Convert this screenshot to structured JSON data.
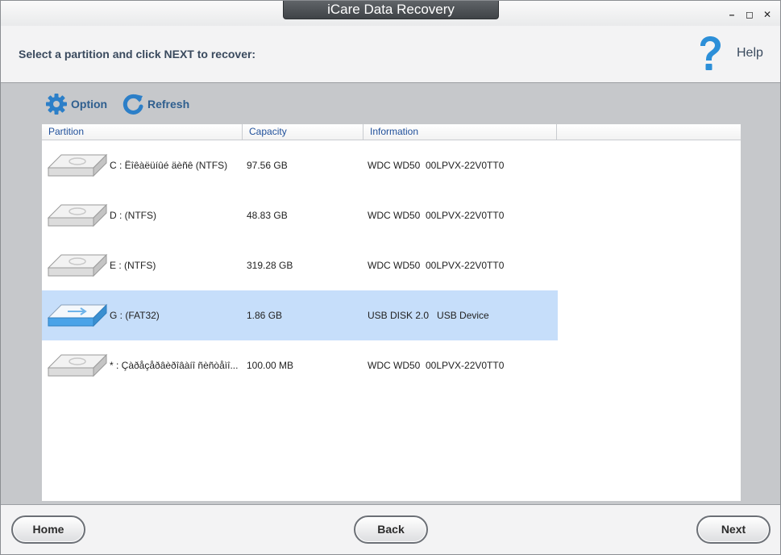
{
  "window": {
    "title": "iCare Data Recovery",
    "controls": {
      "minimize": "–",
      "maximize": "◻",
      "close": "✕"
    }
  },
  "header": {
    "instruction": "Select a partition and click NEXT to recover:",
    "help_label": "Help",
    "help_icon": "question-mark-icon"
  },
  "toolbar": {
    "option_label": "Option",
    "refresh_label": "Refresh"
  },
  "table": {
    "columns": [
      "Partition",
      "Capacity",
      "Information"
    ],
    "rows": [
      {
        "partition": "C : Ëîêàëüíûé äèñê  (NTFS)",
        "capacity": "97.56 GB",
        "information": "WDC WD50  00LPVX-22V0TT0",
        "icon": "hard-disk-icon",
        "selected": false
      },
      {
        "partition": "D :   (NTFS)",
        "capacity": "48.83 GB",
        "information": "WDC WD50  00LPVX-22V0TT0",
        "icon": "hard-disk-icon",
        "selected": false
      },
      {
        "partition": "E :   (NTFS)",
        "capacity": "319.28 GB",
        "information": "WDC WD50  00LPVX-22V0TT0",
        "icon": "hard-disk-icon",
        "selected": false
      },
      {
        "partition": "G :   (FAT32)",
        "capacity": "1.86 GB",
        "information": "USB DISK 2.0   USB Device",
        "icon": "usb-disk-icon",
        "selected": true
      },
      {
        "partition": "* : Çàðåçåðâèðîâàíî ñèñòåìî...",
        "capacity": "100.00 MB",
        "information": "WDC WD50  00LPVX-22V0TT0",
        "icon": "hard-disk-icon",
        "selected": false
      }
    ]
  },
  "footer": {
    "home_label": "Home",
    "back_label": "Back",
    "next_label": "Next"
  },
  "colors": {
    "accent": "#2f5f8f",
    "selected_row": "#c6defa",
    "help_icon": "#2c8fd8",
    "usb_accent": "#4aa3e8"
  }
}
